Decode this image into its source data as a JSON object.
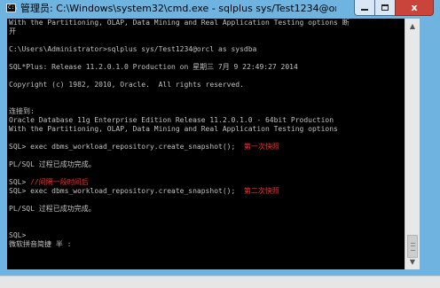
{
  "window": {
    "title": "管理员: C:\\Windows\\system32\\cmd.exe - sqlplus  sys/Test1234@orcl as sy...",
    "app_icon_text": "C:\\",
    "controls": {
      "close_label": "x"
    }
  },
  "console": {
    "lines": [
      {
        "text": "With the Partitioning, OLAP, Data Mining and Real Application Testing options 断"
      },
      {
        "text": "开"
      },
      {
        "text": ""
      },
      {
        "text": "C:\\Users\\Administrator>sqlplus sys/Test1234@orcl as sysdba"
      },
      {
        "text": ""
      },
      {
        "text": "SQL*Plus: Release 11.2.0.1.0 Production on 星期三 7月 9 22:49:27 2014"
      },
      {
        "text": ""
      },
      {
        "text": "Copyright (c) 1982, 2010, Oracle.  All rights reserved."
      },
      {
        "text": ""
      },
      {
        "text": ""
      },
      {
        "text": "连接到:"
      },
      {
        "text": "Oracle Database 11g Enterprise Edition Release 11.2.0.1.0 - 64bit Production"
      },
      {
        "text": "With the Partitioning, OLAP, Data Mining and Real Application Testing options"
      },
      {
        "text": ""
      },
      {
        "text": "SQL> exec dbms_workload_repository.create_snapshot();  ",
        "annotation": "第一次快照"
      },
      {
        "text": ""
      },
      {
        "text": "PL/SQL 过程已成功完成。"
      },
      {
        "text": ""
      },
      {
        "text": "SQL> ",
        "annotation": "//间隔一段时间后"
      },
      {
        "text": "SQL> exec dbms_workload_repository.create_snapshot();  ",
        "annotation": "第二次快照"
      },
      {
        "text": ""
      },
      {
        "text": "PL/SQL 过程已成功完成。"
      },
      {
        "text": ""
      },
      {
        "text": ""
      },
      {
        "text": "SQL>"
      },
      {
        "text": "微软拼音简捷 半 :"
      }
    ],
    "annotation_color": "#ff2a2a"
  },
  "colors": {
    "titlebar": "#6fb3e0",
    "console_background": "#000000",
    "console_text": "#c0c0c0",
    "close_button": "#c9453c"
  },
  "icons": {
    "app": "cmd-icon",
    "minimize": "minimize-icon",
    "maximize": "maximize-icon",
    "close": "close-icon",
    "scroll_up": "scroll-up-arrow-icon",
    "scroll_down": "scroll-down-arrow-icon"
  }
}
